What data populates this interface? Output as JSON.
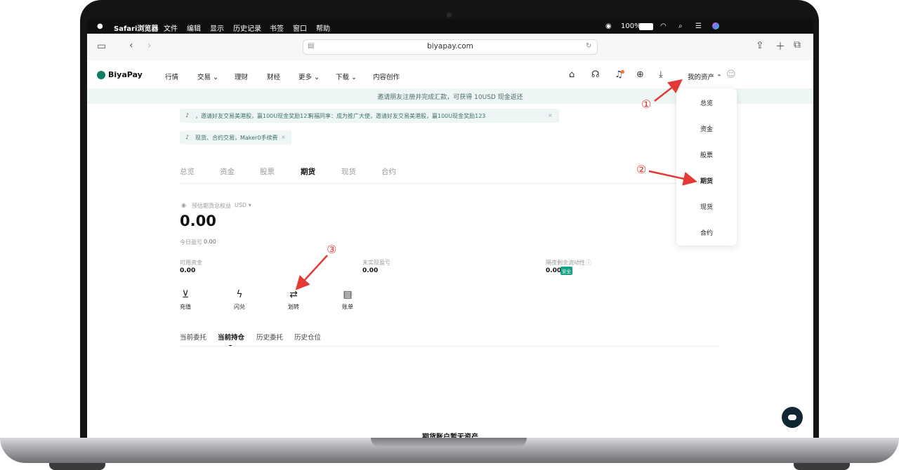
{
  "menubar": {
    "apple": "",
    "app": "Safari浏览器",
    "items": [
      "文件",
      "编辑",
      "显示",
      "历史记录",
      "书签",
      "窗口",
      "帮助"
    ],
    "battery": "100%"
  },
  "safari": {
    "url": "biyapay.com"
  },
  "nav": {
    "logo": "BiyaPay",
    "items": [
      "行情",
      "交易",
      "理财",
      "财经",
      "更多",
      "下载",
      "内容创作"
    ],
    "assets": "我的资产"
  },
  "banner": {
    "text": "邀请朋友注册并完成汇款，可获得 10USD 现金返还"
  },
  "notices": [
    {
      "text": "，邀请好友交易美港股，赢100U现金奖励123",
      "extra": "有福同享：成为推广大使，邀请好友交易美港股，赢100U现金奖励123"
    },
    {
      "text": "现货、合约交易，Maker0手续费"
    }
  ],
  "tabs": [
    "总览",
    "资金",
    "股票",
    "期货",
    "现货",
    "合约"
  ],
  "summary": {
    "label": "预估期货总权益",
    "currency": "USD",
    "total": "0.00",
    "today_pnl_label": "今日盈亏",
    "today_pnl": "0.00",
    "available_label": "可用资金",
    "available": "0.00",
    "unrealized_label": "未实现盈亏",
    "unrealized": "0.00",
    "liquidity_label": "隔夜剩余流动性",
    "liquidity": "0.00",
    "safe_badge": "安全"
  },
  "actions": [
    {
      "icon": "deposit-icon",
      "label": "充值"
    },
    {
      "icon": "flash-icon",
      "label": "闪兑"
    },
    {
      "icon": "transfer-icon",
      "label": "划转"
    },
    {
      "icon": "bill-icon",
      "label": "账单"
    }
  ],
  "order_tabs": [
    "当前委托",
    "当前持仓",
    "历史委托",
    "历史仓位"
  ],
  "empty_text": "期货账户暂无资产",
  "dropdown": [
    "总览",
    "资金",
    "股票",
    "期货",
    "现货",
    "合约"
  ],
  "annotations": [
    "①",
    "②",
    "③"
  ],
  "colors": {
    "accent": "#0b7d61",
    "annotation": "#e53935",
    "banner_bg": "#eef6f5"
  }
}
